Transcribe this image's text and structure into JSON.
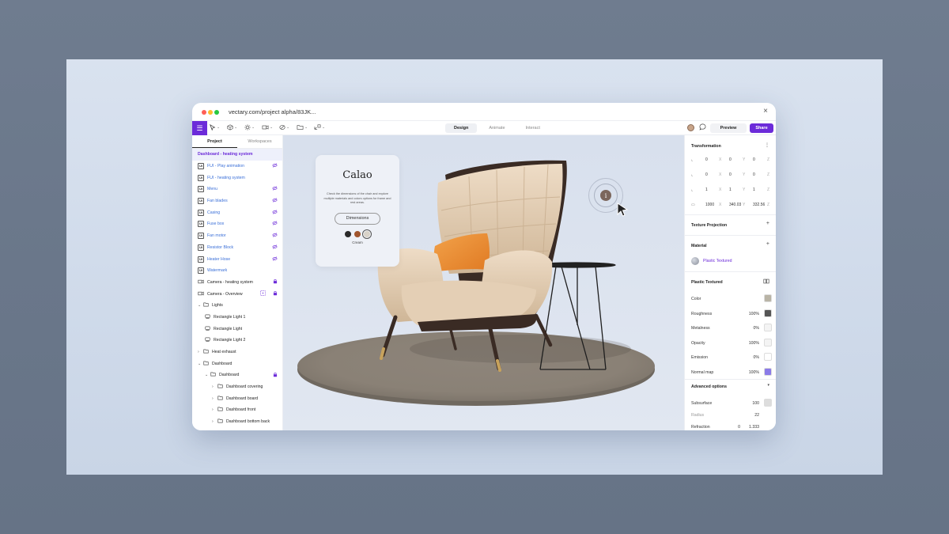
{
  "browser": {
    "url": "vectary.com/project alpha/83JK...",
    "close_icon": "×"
  },
  "toolbar": {
    "modes": [
      "Design",
      "Animate",
      "Interact"
    ],
    "active_mode": "Design",
    "preview_label": "Preview",
    "share_label": "Share",
    "accent": "#6c2bd9"
  },
  "left_panel": {
    "tabs": [
      "Project",
      "Workspaces"
    ],
    "layers": [
      {
        "label": "Dashboard - heating system",
        "type": "selected"
      },
      {
        "label": "FUI - Play animation",
        "type": "ui",
        "badge": "UI",
        "right": "eye-off"
      },
      {
        "label": "FUI - heating system",
        "type": "ui",
        "badge": "UI"
      },
      {
        "label": "Menu",
        "type": "ui",
        "badge": "UI",
        "right": "eye-off"
      },
      {
        "label": "Fan blades",
        "type": "ui",
        "badge": "UI",
        "right": "eye-off"
      },
      {
        "label": "Casing",
        "type": "ui",
        "badge": "UI",
        "right": "eye-off"
      },
      {
        "label": "Fuse box",
        "type": "ui",
        "badge": "UI",
        "right": "eye-off"
      },
      {
        "label": "Fan motor",
        "type": "ui",
        "badge": "UI",
        "right": "eye-off"
      },
      {
        "label": "Resistor Block",
        "type": "ui",
        "badge": "UI",
        "right": "eye-off"
      },
      {
        "label": "Heater Hose",
        "type": "ui",
        "badge": "UI",
        "right": "eye-off"
      },
      {
        "label": "Watermark",
        "type": "ui",
        "badge": "UI"
      },
      {
        "label": "Camera - heating system",
        "type": "camera",
        "right": "lock"
      },
      {
        "label": "Camera - Overview",
        "type": "camera",
        "right": "lock",
        "extra": "target"
      },
      {
        "label": "Lights",
        "type": "folder",
        "open": true
      },
      {
        "label": "Rectangle Light 1",
        "type": "light",
        "indent": 1
      },
      {
        "label": "Rectangle Light",
        "type": "light",
        "indent": 1
      },
      {
        "label": "Rectangle Light 2",
        "type": "light",
        "indent": 1
      },
      {
        "label": "Heat exhaust",
        "type": "folder",
        "open": false
      },
      {
        "label": "Dashboard",
        "type": "folder",
        "open": true
      },
      {
        "label": "Dashboard",
        "type": "folder",
        "open": true,
        "indent": 1,
        "right": "lock"
      },
      {
        "label": "Dashboard covering",
        "type": "folder",
        "open": false,
        "indent": 2
      },
      {
        "label": "Dashboard board",
        "type": "folder",
        "open": false,
        "indent": 2
      },
      {
        "label": "Dashboard front",
        "type": "folder",
        "open": false,
        "indent": 2
      },
      {
        "label": "Dashboard bottom back",
        "type": "folder",
        "open": false,
        "indent": 2
      }
    ]
  },
  "card": {
    "title": "Calao",
    "description": "Check the dimensions of the chair and explore multiple materials and colors options for frame and rest areas.",
    "button_label": "Dimensions",
    "swatches": [
      "#2a2a2a",
      "#a0552d",
      "#d8d2c8"
    ],
    "swatch_label": "Cream"
  },
  "right_panel": {
    "transformation": {
      "title": "Transformation",
      "rows": [
        {
          "a": "0",
          "b": "0",
          "c": "0"
        },
        {
          "a": "0",
          "b": "0",
          "c": "0"
        },
        {
          "a": "1",
          "b": "1",
          "c": "1"
        },
        {
          "a": "1000",
          "b": "340.03",
          "c": "332.56"
        }
      ],
      "axes": [
        "X",
        "Y",
        "Z"
      ]
    },
    "texture_projection": "Texture Projection",
    "material": {
      "title": "Material",
      "name": "Plastic Textured"
    },
    "props_title": "Plastic Textured",
    "props": [
      {
        "label": "Color",
        "value": "",
        "color": "#b9b4a6"
      },
      {
        "label": "Roughness",
        "value": "100%",
        "color": "#555555"
      },
      {
        "label": "Metalness",
        "value": "0%",
        "color": "#f4f4f4"
      },
      {
        "label": "Opacity",
        "value": "100%",
        "color": "#f4f4f4"
      },
      {
        "label": "Emission",
        "value": "0%",
        "color": "#ffffff"
      },
      {
        "label": "Normal map",
        "value": "100%",
        "color": "#8b7be8"
      }
    ],
    "advanced": {
      "title": "Advanced options",
      "rows": [
        {
          "label": "Subsurface",
          "value": "100"
        },
        {
          "label": "Radius",
          "value": "22"
        },
        {
          "label": "Refraction",
          "value": "0",
          "value2": "1.333"
        }
      ]
    }
  }
}
